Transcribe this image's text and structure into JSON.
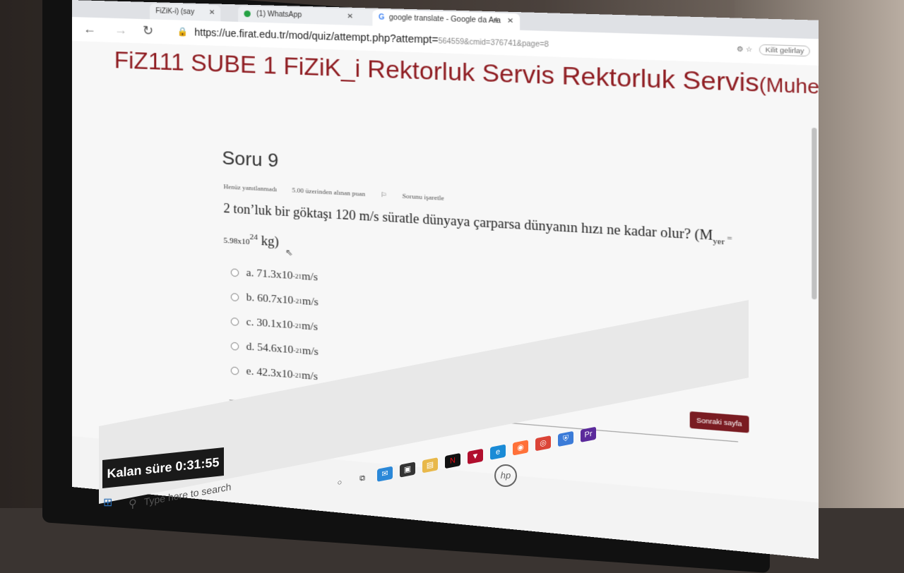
{
  "browser": {
    "tabs": [
      {
        "label": "FiZiK-i) (say",
        "active": false
      },
      {
        "label": "(1) WhatsApp",
        "active": false
      },
      {
        "label": "google translate - Google da Ara",
        "active": true
      }
    ],
    "url_main": "https://ue.firat.edu.tr/mod/quiz/attempt.php?attempt=",
    "url_rest": "564559&cmid=376741&page=8",
    "ext_label": "Kilit gelirlay"
  },
  "course": {
    "title": "FiZ111 SUBE 1 FiZiK_i Rektorluk Servis Rektorluk Servis",
    "title_suffix": "(Muhendislik)"
  },
  "question": {
    "heading": "Soru 9",
    "status": "Henüz yanıtlanmadı",
    "points": "5.00 üzerinden alınan puan",
    "flag": "Sorunu işaretle",
    "text": "2 ton’luk bir göktaşı 120 m/s süratle dünyaya çarparsa dünyanın hızı ne kadar olur? (M",
    "subscript": "yer",
    "text_eq": " = 5.98x10",
    "exponent": "24",
    "text_unit": " kg)",
    "options": [
      {
        "label": "a. 71.3x10",
        "exp": "-21",
        "unit": " m/s"
      },
      {
        "label": "b. 60.7x10",
        "exp": "-21",
        "unit": " m/s"
      },
      {
        "label": "c. 30.1x10",
        "exp": "-21",
        "unit": " m/s"
      },
      {
        "label": "d. 54.6x10",
        "exp": "-21",
        "unit": " m/s"
      },
      {
        "label": "e. 42.3x10",
        "exp": "-21",
        "unit": " m/s"
      }
    ]
  },
  "next_button": "Sonraki sayfa",
  "timer": "Kalan süre 0:31:55",
  "taskbar": {
    "search_placeholder": "Type here to search"
  },
  "colors": {
    "brand": "#8f1d22",
    "button": "#7a1c22"
  }
}
